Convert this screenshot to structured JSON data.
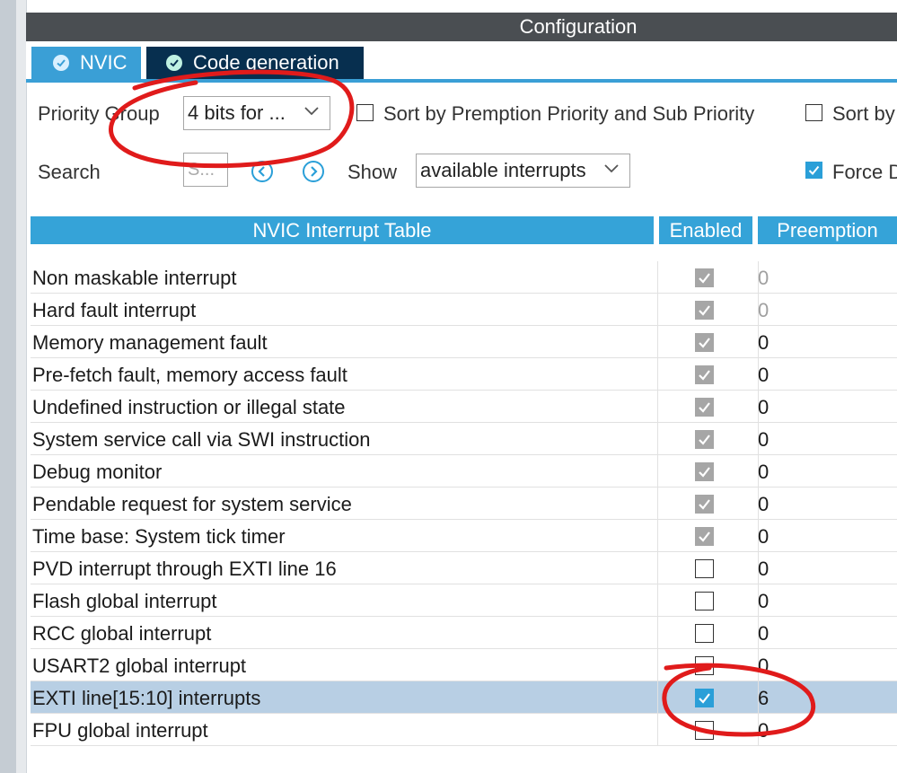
{
  "header": {
    "title": "Configuration"
  },
  "tabs": [
    {
      "label": "NVIC"
    },
    {
      "label": "Code generation"
    }
  ],
  "controls": {
    "priority_group_label": "Priority Group",
    "priority_group_value": "4 bits for ...",
    "sort_preemption_label": "Sort by Premption Priority and Sub Priority",
    "sort_by_label": "Sort by",
    "search_label": "Search",
    "search_placeholder": "S...",
    "show_label": "Show",
    "show_value": "available interrupts",
    "force_label": "Force D"
  },
  "table": {
    "headers": [
      "NVIC Interrupt Table",
      "Enabled",
      "Preemption"
    ],
    "rows": [
      {
        "name": "Non maskable interrupt",
        "enabled": "locked",
        "preemption": "0",
        "dim": true
      },
      {
        "name": "Hard fault interrupt",
        "enabled": "locked",
        "preemption": "0",
        "dim": true
      },
      {
        "name": "Memory management fault",
        "enabled": "locked",
        "preemption": "0"
      },
      {
        "name": "Pre-fetch fault, memory access fault",
        "enabled": "locked",
        "preemption": "0"
      },
      {
        "name": "Undefined instruction or illegal state",
        "enabled": "locked",
        "preemption": "0"
      },
      {
        "name": "System service call via SWI instruction",
        "enabled": "locked",
        "preemption": "0"
      },
      {
        "name": "Debug monitor",
        "enabled": "locked",
        "preemption": "0"
      },
      {
        "name": "Pendable request for system service",
        "enabled": "locked",
        "preemption": "0"
      },
      {
        "name": "Time base: System tick timer",
        "enabled": "locked",
        "preemption": "0"
      },
      {
        "name": "PVD interrupt through EXTI line 16",
        "enabled": "off",
        "preemption": "0"
      },
      {
        "name": "Flash global interrupt",
        "enabled": "off",
        "preemption": "0"
      },
      {
        "name": "RCC global interrupt",
        "enabled": "off",
        "preemption": "0"
      },
      {
        "name": "USART2 global interrupt",
        "enabled": "off",
        "preemption": "0"
      },
      {
        "name": "EXTI line[15:10] interrupts",
        "enabled": "on",
        "preemption": "6",
        "selected": true
      },
      {
        "name": "FPU global interrupt",
        "enabled": "off",
        "preemption": "0"
      }
    ]
  },
  "colors": {
    "accent": "#35a3d8",
    "tab_active": "#072f4f",
    "header_bg": "#4a4e52",
    "selected_row": "#b8cfe4",
    "annotation": "#e01b1b"
  }
}
